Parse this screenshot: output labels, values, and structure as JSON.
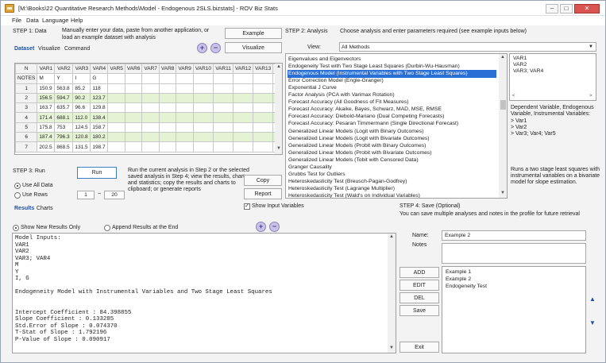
{
  "title": "[M:\\Books\\22 Quantitative Research Methods\\Model - Endogenous 2SLS.bizstats] - ROV Biz Stats",
  "menu": [
    "File",
    "Data",
    "Language",
    "Help"
  ],
  "step1": {
    "label": "STEP 1: Data",
    "desc1": "Manually enter your data, paste from another application, or",
    "desc2": "load an example dataset with analysis",
    "example_btn": "Example",
    "visualize_btn": "Visualize",
    "plus": "+",
    "minus": "−",
    "tabs": [
      "Dataset",
      "Visualize",
      "Command"
    ]
  },
  "grid": {
    "corner": "N",
    "columns": [
      "VAR1",
      "VAR2",
      "VAR3",
      "VAR4",
      "VAR5",
      "VAR6",
      "VAR7",
      "VAR8",
      "VAR9",
      "VAR10",
      "VAR11",
      "VAR12",
      "VAR13",
      "V"
    ],
    "notes_label": "NOTES",
    "notes": [
      "M",
      "Y",
      "I",
      "G",
      "",
      "",
      "",
      "",
      "",
      "",
      "",
      "",
      "",
      ""
    ],
    "rows": [
      {
        "n": "1",
        "cells": [
          "150.9",
          "563.8",
          "85.2",
          "118"
        ]
      },
      {
        "n": "2",
        "cells": [
          "156.5",
          "594.7",
          "90.2",
          "123.7"
        ]
      },
      {
        "n": "3",
        "cells": [
          "163.7",
          "635.7",
          "96.6",
          "129.8"
        ]
      },
      {
        "n": "4",
        "cells": [
          "171.4",
          "688.1",
          "112.0",
          "138.4"
        ]
      },
      {
        "n": "5",
        "cells": [
          "175.8",
          "753",
          "124.5",
          "158.7"
        ]
      },
      {
        "n": "6",
        "cells": [
          "187.4",
          "796.3",
          "120.8",
          "180.2"
        ]
      },
      {
        "n": "7",
        "cells": [
          "202.5",
          "868.5",
          "131.5",
          "198.7"
        ]
      }
    ]
  },
  "step2": {
    "label": "STEP 2: Analysis",
    "desc": "Choose analysis and enter parameters required (see example inputs below)",
    "view_label": "View:",
    "view_value": "All Methods",
    "methods": [
      "Eigenvalues and Eigenvectors",
      "Endogeneity Test with Two Stage Least Squares (Durbin-Wu-Hausman)",
      "Endogenous Model (Instrumental Variables with Two Stage Least Squares)",
      "Error Correction Model (Engle-Granger)",
      "Exponential J Curve",
      "Factor Analysis (PCA with Varimax Rotation)",
      "Forecast Accuracy (All Goodness of Fit Measures)",
      "Forecast Accuracy: Akaike, Bayes, Schwarz, MAD, MSE, RMSE",
      "Forecast Accuracy: Diebold-Mariano (Dual Competing Forecasts)",
      "Forecast Accuracy: Pesaran Timmermann (Single Directional Forecast)",
      "Generalized Linear Models (Logit with Binary Outcomes)",
      "Generalized Linear Models (Logit with Bivariate Outcomes)",
      "Generalized Linear Models (Probit with Binary Outcomes)",
      "Generalized Linear Models (Probit with Bivariate Outcomes)",
      "Generalized Linear Models (Tobit with Censored Data)",
      "Granger Causality",
      "Grubbs Test for Outliers",
      "Heteroskedasticity Test (Breusch-Pagan-Godfrey)",
      "Heteroskedasticity Test (Lagrange Multiplier)",
      "Heteroskedasticity Test (Wald's on Individual Variables)"
    ],
    "selected_index": 2,
    "inputs": [
      "VAR1",
      "VAR2",
      "VAR3; VAR4"
    ],
    "help1": "Dependent Variable, Endogenous",
    "help2": "Variable, Instrumental Variables:",
    "help_items": [
      ">  Var1",
      ">  Var2",
      ">  Var3; Var4; Var5"
    ],
    "desc_lines": [
      "Runs a two stage least squares with",
      "instrumental variables on a bivariate",
      "model for slope estimation."
    ]
  },
  "step3": {
    "label": "STEP 3: Run",
    "run_btn": "Run",
    "desc": [
      "Run the current analysis in Step 2 or the selected",
      "saved analysis in Step 4; view the results, charts,",
      "and statistics; copy the results and charts to",
      "clipboard; or generate reports"
    ],
    "copy_btn": "Copy",
    "report_btn": "Report",
    "use_all": "Use All Data",
    "use_rows": "Use Rows",
    "row_from": "1",
    "row_sep": "~",
    "row_to": "20",
    "show_inputs": "Show Input Variables"
  },
  "results": {
    "tabs": [
      "Results",
      "Charts"
    ],
    "show_new": "Show New Results Only",
    "append": "Append Results at the End",
    "lines": [
      "Model Inputs:",
      "VAR1",
      "VAR2",
      "VAR3; VAR4",
      "M",
      "Y",
      "I, G",
      "",
      "Endogeneity Model with Instrumental Variables and Two Stage Least Squares",
      "",
      "",
      "Intercept Coefficient : 84.398855",
      "Slope Coefficient : 0.133285",
      "Std.Error of Slope : 0.074370",
      "T-Stat of Slope : 1.792196",
      "P-Value of Slope : 0.090917"
    ]
  },
  "step4": {
    "label": "STEP 4: Save (Optional)",
    "desc": "You can save multiple analyses and notes in the profile for future retrieval",
    "name_label": "Name:",
    "name_value": "Example 2",
    "notes_label": "Notes",
    "add_btn": "ADD",
    "edit_btn": "EDIT",
    "del_btn": "DEL",
    "save_btn": "Save",
    "exit_btn": "Exit",
    "saved": [
      "Example 1",
      "Example 2",
      "Endogeneity Test"
    ]
  }
}
